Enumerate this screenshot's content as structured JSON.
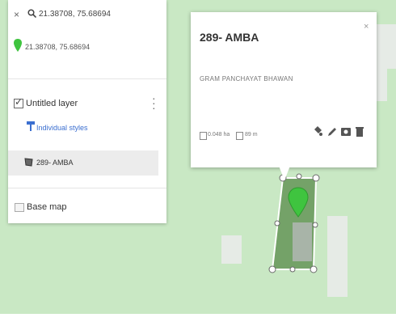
{
  "search": {
    "query": "21.38708, 75.68694"
  },
  "location": {
    "coords": "21.38708, 75.68694"
  },
  "layer": {
    "title": "Untitled layer",
    "styles_label": "Individual styles",
    "feature_label": "289- AMBA"
  },
  "base_map": {
    "label": "Base map"
  },
  "popup": {
    "title": "289- AMBA",
    "description": "GRAM PANCHAYAT BHAWAN",
    "area": "0.048 ha",
    "perimeter": "89 m",
    "close": "×"
  },
  "colors": {
    "map_bg": "#c9e8c4",
    "polygon_fill": "#6a9a5e",
    "pin": "#3fc43f",
    "link": "#3b6fd0"
  }
}
